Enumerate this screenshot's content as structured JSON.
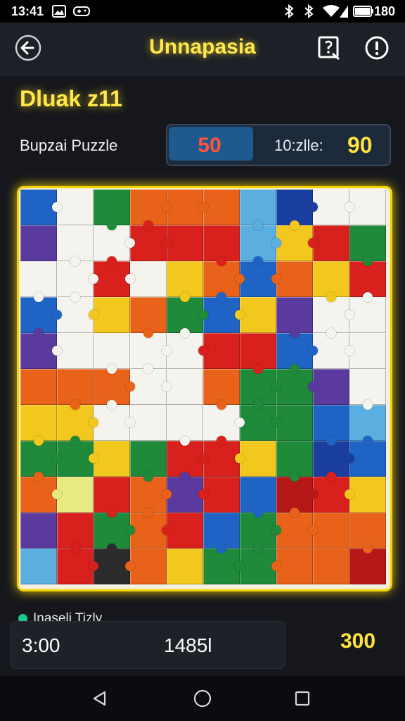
{
  "status_bar": {
    "time": "13:41",
    "battery": "180",
    "icons": [
      "gallery-icon",
      "gamepad-icon",
      "bluetooth-icon",
      "bluetooth-icon",
      "wifi-icon",
      "signal-icon",
      "battery-icon"
    ]
  },
  "app_bar": {
    "title": "Unnapasia",
    "back_icon": "back-arrow-icon",
    "action_icons": [
      "hint-icon",
      "info-icon"
    ]
  },
  "level": {
    "label": "Dluak z11",
    "puzzle_name": "Bupzai Puzzle"
  },
  "score_panel": {
    "left_value": "50",
    "right_label": "10:zlle:",
    "right_value": "90"
  },
  "board": {
    "columns": 10,
    "rows": 11,
    "grid": [
      "BWGOOOLNWW",
      "PWWRRRLYRG",
      "WWRWYOBOYR",
      "BWYOGBYPWW",
      "PWWWWRRBWW",
      "OOOWWOGGPW",
      "YYWWWWGGBL",
      "GGYGRRYGNB",
      "OMROPRBDRY",
      "PRGORBGOOO",
      "LRKOYGGOOD"
    ],
    "palette": {
      "R": "#d8201c",
      "O": "#e8621a",
      "Y": "#f2c81e",
      "G": "#1e8a3a",
      "B": "#1f64c4",
      "N": "#1a3f9e",
      "L": "#5aaee0",
      "P": "#5a3a9e",
      "W": "#f4f3ee",
      "M": "#e6ea80",
      "K": "#2c2c2c",
      "D": "#b61818"
    }
  },
  "footer": {
    "label": "Inaseli Tizly",
    "time": "3:00",
    "count": "1485l",
    "score": "300"
  },
  "nav_bar": {
    "icons": [
      "back-icon",
      "home-icon",
      "recents-icon"
    ]
  },
  "colors": {
    "accent": "#ffe84a",
    "frame": "#f4d400",
    "score_red": "#ff5340"
  }
}
